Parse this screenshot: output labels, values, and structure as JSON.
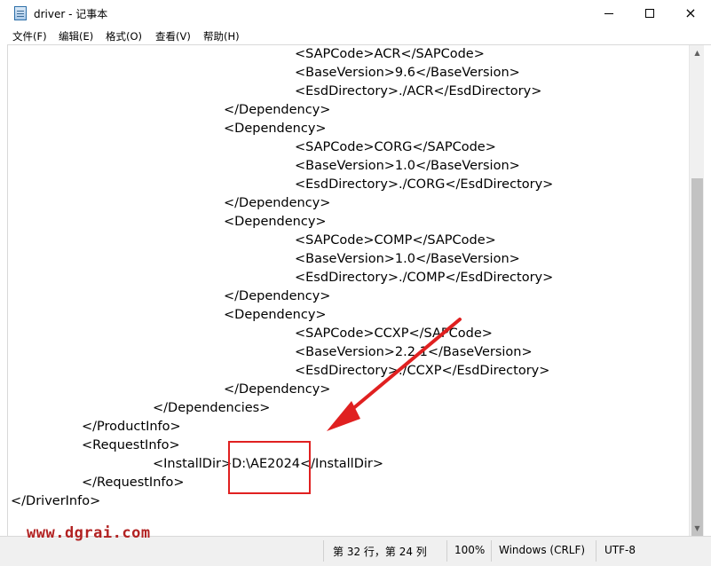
{
  "window": {
    "title": "driver - 记事本",
    "controls": {
      "minimize": "minimize",
      "maximize": "maximize",
      "close": "×"
    }
  },
  "menu": {
    "file": "文件(F)",
    "edit": "编辑(E)",
    "format": "格式(O)",
    "view": "查看(V)",
    "help": "帮助(H)"
  },
  "editor": {
    "lines": [
      "<SAPCode>ACR</SAPCode>",
      "<BaseVersion>9.6</BaseVersion>",
      "<EsdDirectory>./ACR</EsdDirectory>",
      "</Dependency>",
      "<Dependency>",
      "<SAPCode>CORG</SAPCode>",
      "<BaseVersion>1.0</BaseVersion>",
      "<EsdDirectory>./CORG</EsdDirectory>",
      "</Dependency>",
      "<Dependency>",
      "<SAPCode>COMP</SAPCode>",
      "<BaseVersion>1.0</BaseVersion>",
      "<EsdDirectory>./COMP</EsdDirectory>",
      "</Dependency>",
      "<Dependency>",
      "<SAPCode>CCXP</SAPCode>",
      "<BaseVersion>2.2.1</BaseVersion>",
      "<EsdDirectory>./CCXP</EsdDirectory>",
      "</Dependency>",
      "</Dependencies>",
      "</ProductInfo>",
      "<RequestInfo>",
      "<InstallDir>D:\\AE2024</InstallDir>",
      "</RequestInfo>",
      "</DriverInfo>"
    ]
  },
  "status": {
    "position": "第 32 行，第 24 列",
    "zoom": "100%",
    "line_ending": "Windows (CRLF)",
    "encoding": "UTF-8"
  },
  "watermark": "www.dgrai.com",
  "annotation": {
    "color": "#e02020"
  }
}
